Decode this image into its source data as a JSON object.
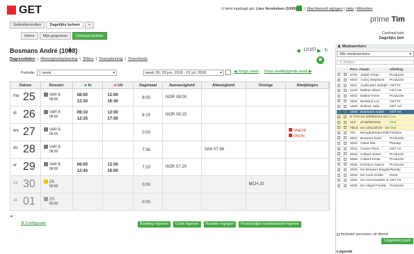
{
  "header": {
    "logo": "GET",
    "login_prefix": "U bent ingelogd als:",
    "user": "Lies Verstreken (1009)",
    "links": [
      "Wachtwoord wijzigen",
      "Help",
      "Afmelden"
    ],
    "brand_light": "prime ",
    "brand_bold": "Tim"
  },
  "tabs": [
    {
      "label": "Gebruikersrollen",
      "active": false
    },
    {
      "label": "Dagelijks beheer",
      "active": true
    },
    {
      "label": "+",
      "active": false
    }
  ],
  "nav": [
    {
      "label": "Home"
    },
    {
      "label": "Mijn gegevens"
    },
    {
      "label": "Centraal beheer"
    }
  ],
  "right_title": {
    "l1": "Centraal beh",
    "l2": "Dagelijks beh"
  },
  "employee": {
    "name": "Bosmans André (1008)",
    "count": "12/107"
  },
  "subtabs": [
    "Dagresultaten",
    "Afwezigheidsplanning",
    "Tellers",
    "Teamplanning",
    "Timesheets"
  ],
  "period": {
    "label": "Periode:",
    "value": "1 week",
    "week": "week 26: 25 jun. 2018 - 01 jul. 2018",
    "prev": "Vorige week",
    "this": "Deze week",
    "next": "Volgende week"
  },
  "columns": [
    "Datum",
    "Rooster",
    "In",
    "Uit",
    "Dagtotaal",
    "Aanwezigheid",
    "Afwezigheid",
    "Overige",
    "Afwijkingen"
  ],
  "days": [
    {
      "dow": "ma",
      "num": "25",
      "code": "VAR B",
      "time": "08:00",
      "in": "08:00\n12:30",
      "out": "12:00\n16:30",
      "total": "8:00",
      "presence": "NOR 08:00",
      "absence": "",
      "other": "",
      "warn": ""
    },
    {
      "dow": "di",
      "num": "26",
      "code": "VAR B",
      "time": "08:00",
      "in": "08:10\n12:35",
      "out": "12:00\n17:00",
      "total": "8:15",
      "presence": "NOR 08:15",
      "absence": "",
      "other": "",
      "warn": ""
    },
    {
      "dow": "wo",
      "num": "27",
      "code": "VAR B",
      "time": "08:00",
      "in": "",
      "out": "",
      "total": "0:00",
      "presence": "",
      "absence": "",
      "other": "",
      "warn": "ONEVE\nONON"
    },
    {
      "dow": "do",
      "num": "28",
      "code": "VAR B",
      "time": "08:00",
      "in": "",
      "out": "",
      "total": "7:36",
      "presence": "",
      "absence": "VAK 07:36",
      "other": "",
      "warn": ""
    },
    {
      "dow": "vr",
      "num": "29",
      "code": "VAR B",
      "time": "08:00",
      "in": "08:00\n12:40",
      "out": "12:00\n16:00",
      "total": "7:20",
      "presence": "NOR 07:20",
      "absence": "",
      "other": "",
      "warn": ""
    },
    {
      "dow": "za",
      "num": "30",
      "code": "ZA",
      "time": "00:00",
      "in": "",
      "out": "",
      "total": "0:00",
      "presence": "",
      "absence": "",
      "other": "MCH 20",
      "warn": ""
    },
    {
      "dow": "zo",
      "num": "01",
      "code": "ZO",
      "time": "00:00",
      "in": "",
      "out": "",
      "total": "0:00",
      "presence": "",
      "absence": "",
      "other": "",
      "warn": ""
    }
  ],
  "footer": {
    "config": "Configuratie",
    "buttons": [
      "Boeking ingeven",
      "Code ingeven",
      "Rooster wijzigen",
      "Persoonlijke roosterwissel ingeven"
    ]
  },
  "right_panel": {
    "title": "Medewerkers",
    "select": "Alle medewerkers",
    "search": "Zoeken",
    "header": [
      "",
      "Pers. nr",
      "Naam",
      "Afdeling"
    ],
    "rows": [
      {
        "nr": "6701",
        "name": "Abdel Achan",
        "dep": "Productie",
        "style": ""
      },
      {
        "nr": "6003",
        "name": "Aubry Stephane",
        "dep": "Productie",
        "style": ""
      },
      {
        "nr": "2011",
        "name": "Audenaert Joseph",
        "dep": "GET Pr",
        "style": ""
      },
      {
        "nr": "2100",
        "name": "Bakker Albert",
        "dep": "GET Ne",
        "style": ""
      },
      {
        "nr": "6003",
        "name": "Bakker Kees",
        "dep": "Productie",
        "style": ""
      },
      {
        "nr": "2004",
        "name": "Bertrand Luc",
        "dep": "GET Pr",
        "style": ""
      },
      {
        "nr": "1000",
        "name": "Boltens Julie",
        "dep": "GET Ad",
        "style": ""
      },
      {
        "nr": "1008",
        "name": "Bosmans André",
        "dep": "GET Ad",
        "style": "sel"
      },
      {
        "nr": "E TAG",
        "name": "wo 20/06/2018 00:00",
        "dep": "Coo",
        "style": "yel"
      },
      {
        "nr": "VLF",
        "name": "di 05/06/2018",
        "dep": "Ond",
        "style": "yel"
      },
      {
        "nr": "TELE",
        "name": "wo 14/11/2018 - 15/11/2018",
        "dep": "Ond",
        "style": "yel"
      },
      {
        "nr": "701",
        "name": "Breughelmans Edith",
        "dep": "Fienpos",
        "style": ""
      },
      {
        "nr": "6002",
        "name": "Broeens Karel",
        "dep": "Productie",
        "style": ""
      },
      {
        "nr": "4023",
        "name": "Claes Mia",
        "dep": "Planisp",
        "style": ""
      },
      {
        "nr": "2016",
        "name": "Coene Flora",
        "dep": "GET Or",
        "style": ""
      },
      {
        "nr": "5019",
        "name": "Collard Josee",
        "dep": "Productie",
        "style": ""
      },
      {
        "nr": "5059",
        "name": "Collard Emile",
        "dep": "Productie",
        "style": ""
      },
      {
        "nr": "5036",
        "name": "D'Orsino Gianni",
        "dep": "Productie",
        "style": ""
      },
      {
        "nr": "4026",
        "name": "De Brouwer Magda",
        "dep": "Planisp",
        "style": ""
      },
      {
        "nr": "4015",
        "name": "De Cock Kristin",
        "dep": "Dorst",
        "style": ""
      },
      {
        "nr": "2020",
        "name": "De Keersmaeker E",
        "dep": "GET Or",
        "style": ""
      },
      {
        "nr": "5026",
        "name": "De Vlegel Freddy",
        "dep": "Productie",
        "style": ""
      }
    ],
    "include": "Inclusief personen uit dienst",
    "adv": "Uitgebreid zoek",
    "legend": "Legende"
  },
  "colors": {
    "brand": "#e4262b",
    "accent": "#45a745",
    "selected": "#3d6f91"
  }
}
